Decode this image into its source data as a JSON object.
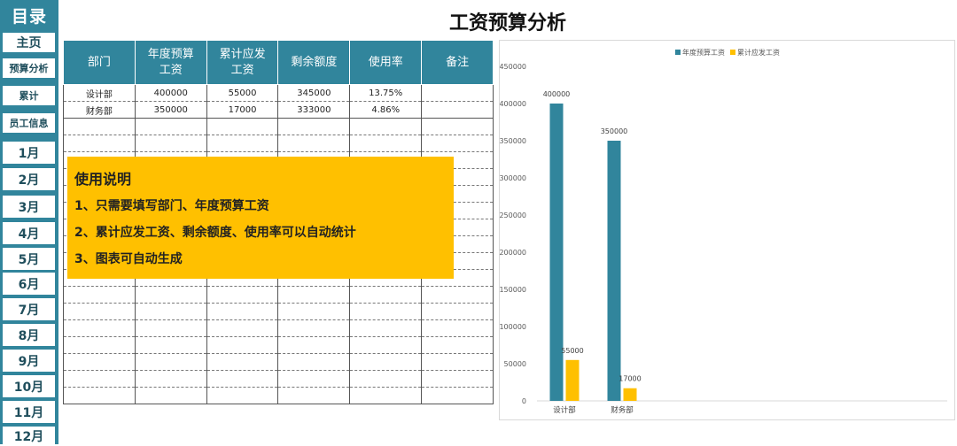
{
  "sidebar": {
    "title": "目录",
    "items": [
      "主页",
      "预算分析",
      "累计",
      "员工信息",
      "1月",
      "2月",
      "3月",
      "4月",
      "5月",
      "6月",
      "7月",
      "8月",
      "9月",
      "10月",
      "11月",
      "12月"
    ]
  },
  "page_title": "工资预算分析",
  "table": {
    "headers": [
      "部门",
      "年度预算工资",
      "累计应发工资",
      "剩余额度",
      "使用率",
      "备注"
    ],
    "rows": [
      [
        "设计部",
        "400000",
        "55000",
        "345000",
        "13.75%",
        ""
      ],
      [
        "财务部",
        "350000",
        "17000",
        "333000",
        "4.86%",
        ""
      ]
    ]
  },
  "note": {
    "heading": "使用说明",
    "lines": [
      "1、只需要填写部门、年度预算工资",
      "2、累计应发工资、剩余额度、使用率可以自动统计",
      "3、图表可自动生成"
    ]
  },
  "colors": {
    "teal": "#31859c",
    "gold": "#ffc000"
  },
  "chart_data": {
    "type": "bar",
    "categories": [
      "设计部",
      "财务部"
    ],
    "series": [
      {
        "name": "年度预算工资",
        "values": [
          400000,
          350000
        ]
      },
      {
        "name": "累计应发工资",
        "values": [
          55000,
          17000
        ]
      }
    ],
    "ylim": [
      0,
      450000
    ],
    "yticks": [
      "0",
      "50000",
      "100000",
      "150000",
      "200000",
      "250000",
      "300000",
      "350000",
      "400000",
      "450000"
    ],
    "legend": "top",
    "grid": false
  }
}
